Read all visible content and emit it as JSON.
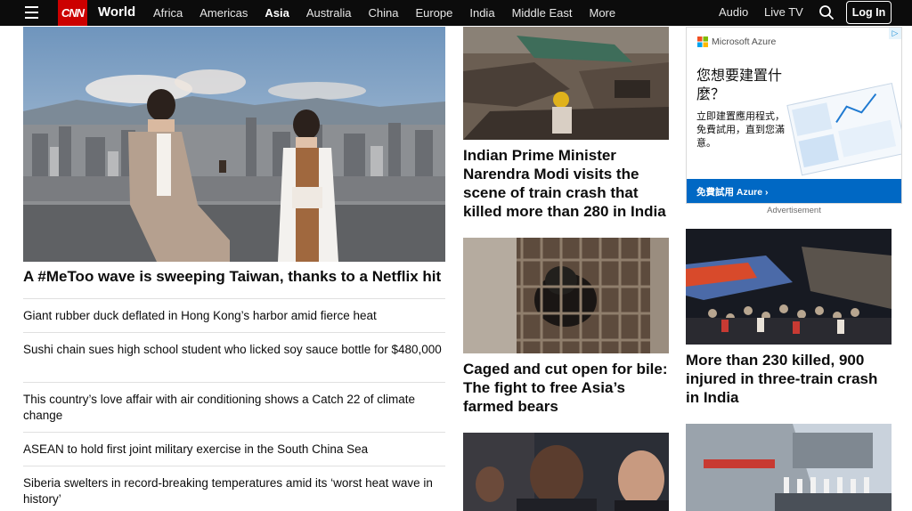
{
  "nav": {
    "section": "World",
    "logo_text": "CNN",
    "links": [
      "Africa",
      "Americas",
      "Asia",
      "Australia",
      "China",
      "Europe",
      "India",
      "Middle East",
      "More"
    ],
    "active": "Asia",
    "audio": "Audio",
    "live_tv": "Live TV",
    "login": "Log In"
  },
  "hero": {
    "headline": "A #MeToo wave is sweeping Taiwan, thanks to a Netflix hit"
  },
  "list": [
    "Giant rubber duck deflated in Hong Kong’s harbor amid fierce heat",
    "Sushi chain sues high school student who licked soy sauce bottle for $480,000",
    "This country’s love affair with air conditioning shows a Catch 22 of climate change",
    "ASEAN to hold first joint military exercise in the South China Sea",
    "Siberia swelters in record-breaking temperatures amid its ‘worst heat wave in history’"
  ],
  "mid": [
    {
      "headline": "Indian Prime Minister Narendra Modi visits the scene of train crash that killed more than 280 in India"
    },
    {
      "headline": "Caged and cut open for bile: The fight to free Asia’s farmed bears"
    },
    {
      "headline": ""
    }
  ],
  "right": [
    {
      "headline": "More than 230 killed, 900 injured in three-train crash in India"
    }
  ],
  "ad": {
    "brand": "Microsoft Azure",
    "heading": "您想要建置什麼？",
    "body": "立即建置應用程式，免費試用，直到您滿意。",
    "cta": "免費試用 Azure ›",
    "label": "Advertisement"
  }
}
